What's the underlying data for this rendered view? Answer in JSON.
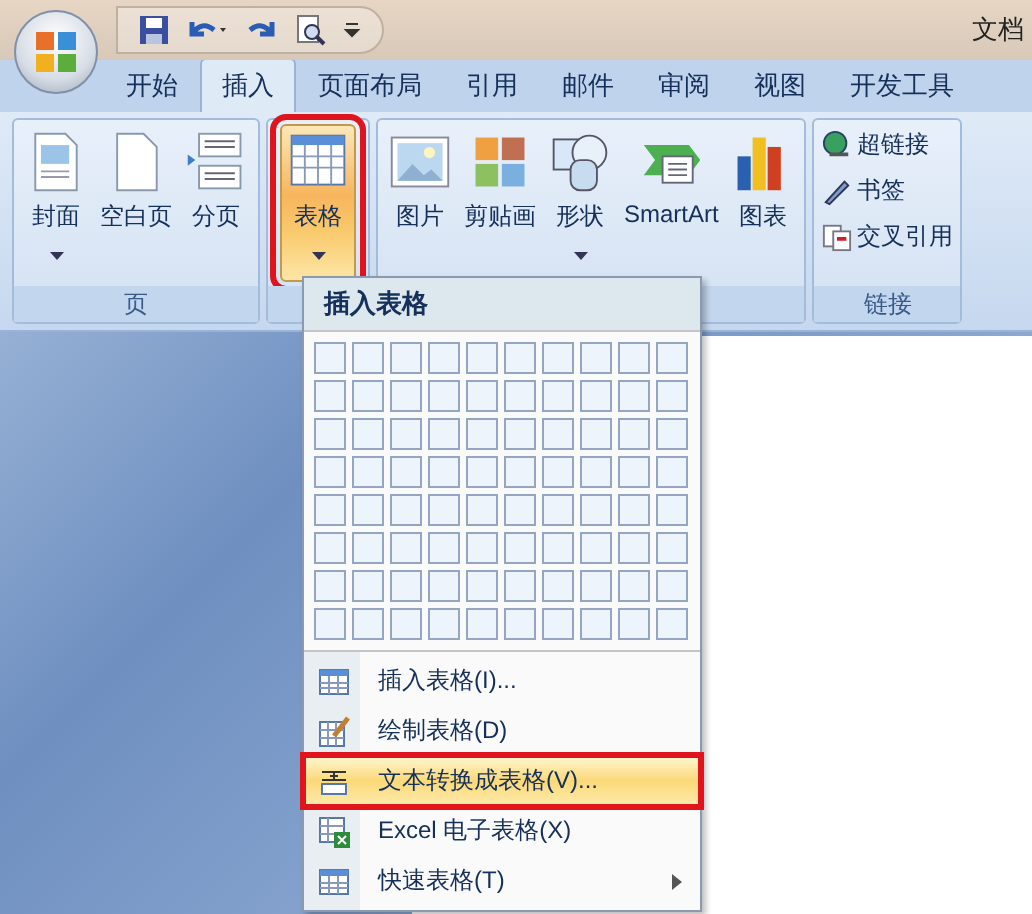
{
  "window": {
    "title": "文档"
  },
  "tabs": [
    {
      "label": "开始",
      "selected": false
    },
    {
      "label": "插入",
      "selected": true
    },
    {
      "label": "页面布局",
      "selected": false
    },
    {
      "label": "引用",
      "selected": false
    },
    {
      "label": "邮件",
      "selected": false
    },
    {
      "label": "审阅",
      "selected": false
    },
    {
      "label": "视图",
      "selected": false
    },
    {
      "label": "开发工具",
      "selected": false
    }
  ],
  "ribbon": {
    "groups": [
      {
        "label": "页",
        "kind": "large",
        "buttons": [
          {
            "label": "封面",
            "kind": "cover",
            "dropdown": true,
            "selected": false
          },
          {
            "label": "空白页",
            "kind": "blank",
            "dropdown": false,
            "selected": false
          },
          {
            "label": "分页",
            "kind": "break",
            "dropdown": false,
            "selected": false
          }
        ]
      },
      {
        "kind": "large",
        "buttons": [
          {
            "label": "表格",
            "kind": "table",
            "dropdown": true,
            "selected": true
          }
        ]
      },
      {
        "kind": "large",
        "buttons": [
          {
            "label": "图片",
            "kind": "picture",
            "dropdown": false,
            "selected": false
          },
          {
            "label": "剪贴画",
            "kind": "clipart",
            "dropdown": false,
            "selected": false
          },
          {
            "label": "形状",
            "kind": "shapes",
            "dropdown": true,
            "selected": false
          },
          {
            "label": "SmartArt",
            "kind": "smartart",
            "dropdown": false,
            "selected": false
          },
          {
            "label": "图表",
            "kind": "chart",
            "dropdown": false,
            "selected": false
          }
        ]
      },
      {
        "label": "链接",
        "kind": "small",
        "buttons": [
          {
            "label": "超链接",
            "kind": "hyperlink"
          },
          {
            "label": "书签",
            "kind": "bookmark"
          },
          {
            "label": "交叉引用",
            "kind": "crossref"
          }
        ]
      }
    ]
  },
  "table_menu": {
    "title": "插入表格",
    "items": [
      {
        "label": "插入表格(I)...",
        "kind": "table",
        "selected": false,
        "submenu": false
      },
      {
        "label": "绘制表格(D)",
        "kind": "draw",
        "selected": false,
        "submenu": false
      },
      {
        "label": "文本转换成表格(V)...",
        "kind": "convert",
        "selected": true,
        "submenu": false
      },
      {
        "label": "Excel 电子表格(X)",
        "kind": "excel",
        "selected": false,
        "submenu": false
      },
      {
        "label": "快速表格(T)",
        "kind": "quick",
        "selected": false,
        "submenu": true
      }
    ]
  }
}
